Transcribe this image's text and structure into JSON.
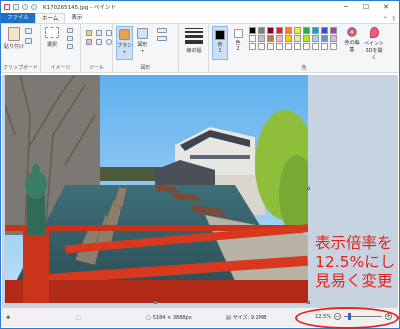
{
  "window": {
    "title": "K170265145.jpg - ペイント",
    "minimize": "─",
    "maximize": "☐",
    "close": "✕"
  },
  "tabs": [
    {
      "label": "ファイル"
    },
    {
      "label": "ホーム"
    },
    {
      "label": "表示"
    }
  ],
  "ribbon": {
    "clipboard": {
      "paste": "貼り付け",
      "group": "クリップボード"
    },
    "image": {
      "select": "選択",
      "group": "イメージ"
    },
    "tools": {
      "group": "ツール"
    },
    "shapes": {
      "brush": "ブラシ",
      "shapes": "図形",
      "group": "図形"
    },
    "size": {
      "label": "線の幅"
    },
    "colors": {
      "color1": "色\n1",
      "color2": "色\n2",
      "edit": "色の編集",
      "paint3d": "ペイント3Dを開く",
      "group": "色",
      "palette": [
        "#000000",
        "#7f7f7f",
        "#880015",
        "#ed1c24",
        "#ff7f27",
        "#fff200",
        "#22b14c",
        "#00a2e8",
        "#3f48cc",
        "#a349a4",
        "#ffffff",
        "#c3c3c3",
        "#b97a57",
        "#ffaec9",
        "#ffc90e",
        "#efe4b0",
        "#b5e61d",
        "#99d9ea",
        "#7092be",
        "#c8bfe7",
        "#ffffff",
        "#ffffff",
        "#ffffff",
        "#ffffff",
        "#ffffff",
        "#ffffff",
        "#ffffff",
        "#ffffff",
        "#ffffff",
        "#ffffff"
      ]
    }
  },
  "annotation": {
    "lines": [
      "表示倍率を",
      "12.5%にし",
      "見易く変更"
    ]
  },
  "status": {
    "dimensions": "5184 × 3888px",
    "filesize": "サイズ: 9.2MB",
    "zoom": "12.5%",
    "zoom_level": 0.125
  }
}
